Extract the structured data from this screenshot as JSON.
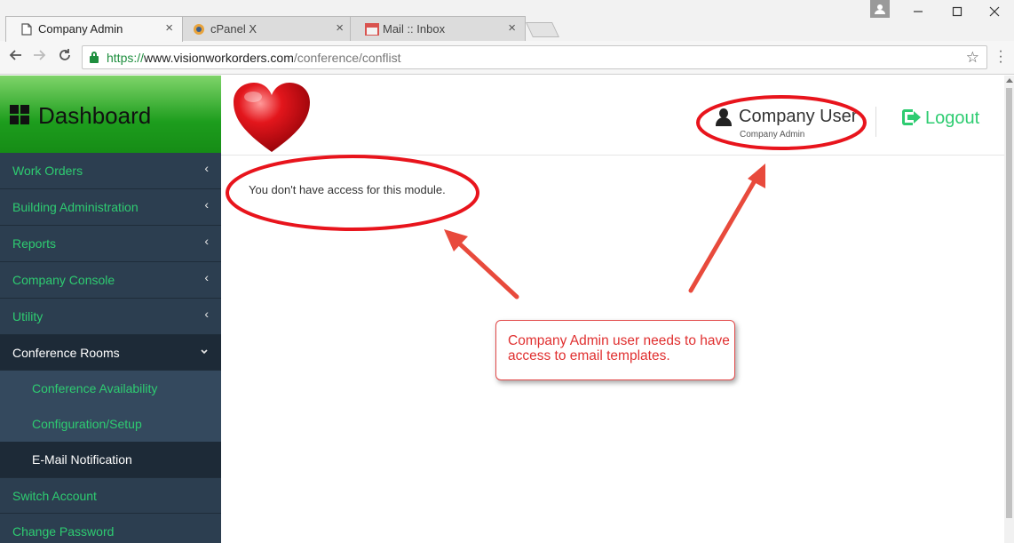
{
  "browser": {
    "tabs": [
      {
        "title": "Company Admin",
        "icon": "page-icon",
        "active": true
      },
      {
        "title": "cPanel X",
        "icon": "cpanel-icon",
        "active": false
      },
      {
        "title": "Mail :: Inbox",
        "icon": "calendar-icon",
        "active": false
      }
    ],
    "close_glyph": "×",
    "url": {
      "scheme": "https://",
      "host": "www.visionworkorders.com",
      "path": "/conference/conflist"
    }
  },
  "sidebar": {
    "title": "Dashboard",
    "items": [
      {
        "label": "Work Orders"
      },
      {
        "label": "Building Administration"
      },
      {
        "label": "Reports"
      },
      {
        "label": "Company Console"
      },
      {
        "label": "Utility"
      },
      {
        "label": "Conference Rooms"
      },
      {
        "label": "Switch Account"
      },
      {
        "label": "Change Password"
      }
    ],
    "subitems": [
      {
        "label": "Conference Availability"
      },
      {
        "label": "Configuration/Setup"
      },
      {
        "label": "E-Mail Notification"
      }
    ]
  },
  "header": {
    "user_name": "Company User",
    "user_role": "Company Admin",
    "logout_label": "Logout"
  },
  "main": {
    "message": "You don't have access for this module."
  },
  "annotation": {
    "text": "Company Admin user needs to have access to email templates."
  },
  "colors": {
    "sidebar_bg": "#2c3e50",
    "accent_green": "#2ecc71",
    "annotation_red": "#e03030",
    "brand_green": "#1d9d1d"
  }
}
